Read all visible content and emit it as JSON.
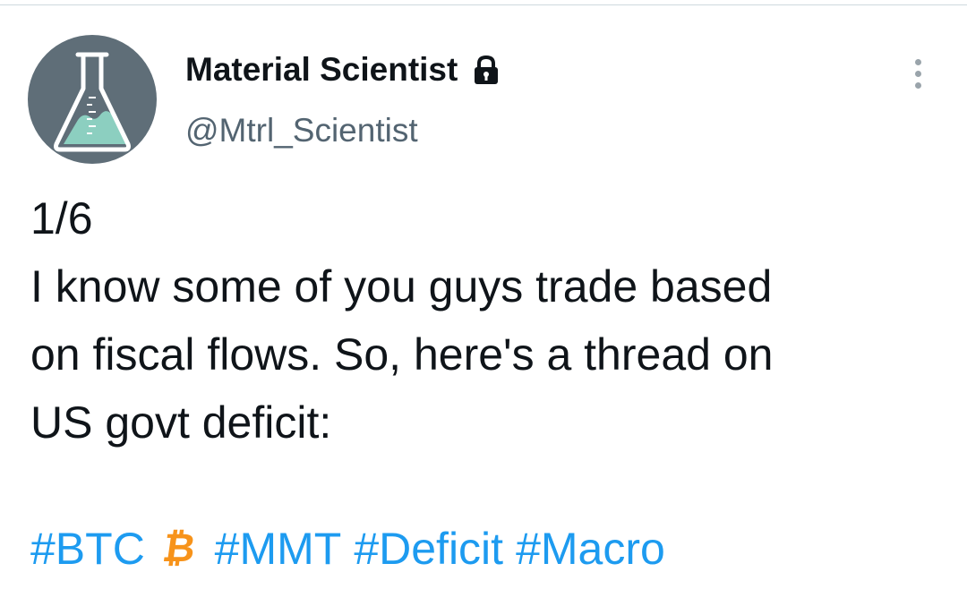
{
  "tweet": {
    "author": {
      "display_name": "Material Scientist",
      "handle": "@Mtrl_Scientist",
      "avatar_icon": "flask-icon",
      "protected_icon": "lock-icon"
    },
    "text": "1/6\nI know some of you guys trade based\non fiscal flows. So, here's a thread on\nUS govt deficit:",
    "hashtags": [
      "#BTC",
      "#MMT",
      "#Deficit",
      "#Macro"
    ],
    "emoji": "₿",
    "menu_icon": "more-vertical-icon"
  },
  "colors": {
    "link": "#1d9bf0",
    "text": "#0f1419",
    "secondary": "#536471",
    "avatar_bg": "#5f6e78",
    "bitcoin": "#f7931a"
  }
}
